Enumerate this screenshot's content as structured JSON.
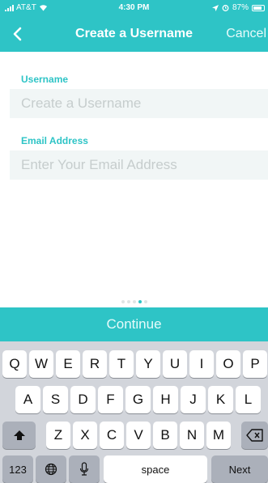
{
  "status_bar": {
    "carrier": "AT&T",
    "time": "4:30 PM",
    "battery": "87%"
  },
  "nav": {
    "title": "Create a Username",
    "cancel_label": "Cancel"
  },
  "form": {
    "username_label": "Username",
    "username_placeholder": "Create a Username",
    "username_value": "",
    "email_label": "Email Address",
    "email_placeholder": "Enter Your Email Address",
    "email_value": ""
  },
  "page_dots": {
    "count": 5,
    "active_index": 3
  },
  "continue_label": "Continue",
  "keyboard": {
    "row1": [
      "Q",
      "W",
      "E",
      "R",
      "T",
      "Y",
      "U",
      "I",
      "O",
      "P"
    ],
    "row2": [
      "A",
      "S",
      "D",
      "F",
      "G",
      "H",
      "J",
      "K",
      "L"
    ],
    "row3": [
      "Z",
      "X",
      "C",
      "V",
      "B",
      "N",
      "M"
    ],
    "numbers_label": "123",
    "space_label": "space",
    "next_label": "Next"
  },
  "colors": {
    "accent": "#2ec4c6",
    "input_bg": "#f1f6f6",
    "keyboard_bg": "#d2d5db"
  }
}
